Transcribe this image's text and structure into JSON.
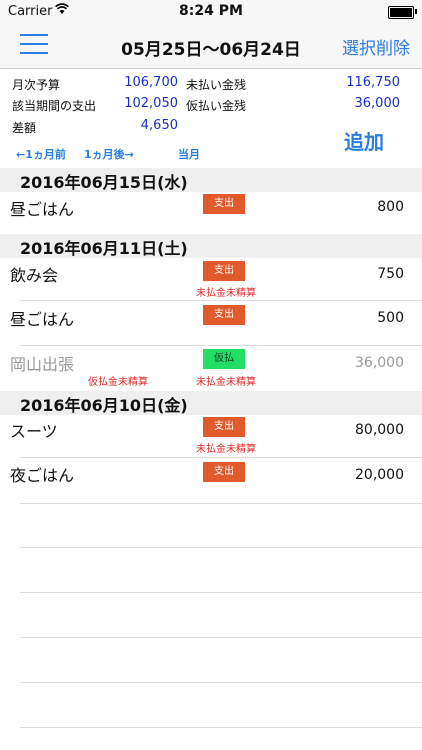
{
  "status": {
    "carrier": "Carrier",
    "time": "8:24 PM"
  },
  "nav": {
    "title": "05月25日〜06月24日",
    "delete_label": "選択削除"
  },
  "summary": {
    "budget_label": "月次予算",
    "budget_value": "106,700",
    "unpaid_label": "未払い金残",
    "unpaid_value": "116,750",
    "expense_label": "該当期間の支出",
    "expense_value": "102,050",
    "advance_label": "仮払い金残",
    "advance_value": "36,000",
    "diff_label": "差額",
    "diff_value": "4,650"
  },
  "period": {
    "prev": "←1ヵ月前",
    "next": "1ヵ月後→",
    "current": "当月"
  },
  "add_label": "追加",
  "sections": [
    {
      "date": "2016年06月15日(水)"
    },
    {
      "date": "2016年06月11日(土)"
    },
    {
      "date": "2016年06月10日(金)"
    }
  ],
  "entries": [
    {
      "name": "昼ごはん",
      "tag": "支出",
      "amount": "800"
    },
    {
      "name": "飲み会",
      "tag": "支出",
      "warn_right": "未払金未精算",
      "amount": "750"
    },
    {
      "name": "昼ごはん",
      "tag": "支出",
      "amount": "500"
    },
    {
      "name": "岡山出張",
      "tag": "仮払",
      "warn_left": "仮払金未精算",
      "warn_right": "未払金未精算",
      "amount": "36,000"
    },
    {
      "name": "スーツ",
      "tag": "支出",
      "warn_right": "未払金未精算",
      "amount": "80,000"
    },
    {
      "name": "夜ごはん",
      "tag": "支出",
      "amount": "20,000"
    }
  ],
  "colors": {
    "accent": "#2a7de1",
    "value_blue": "#1a2fc4",
    "tag_expense": "#e05a2b",
    "tag_advance": "#22dd66",
    "warning": "#e02b2b"
  }
}
